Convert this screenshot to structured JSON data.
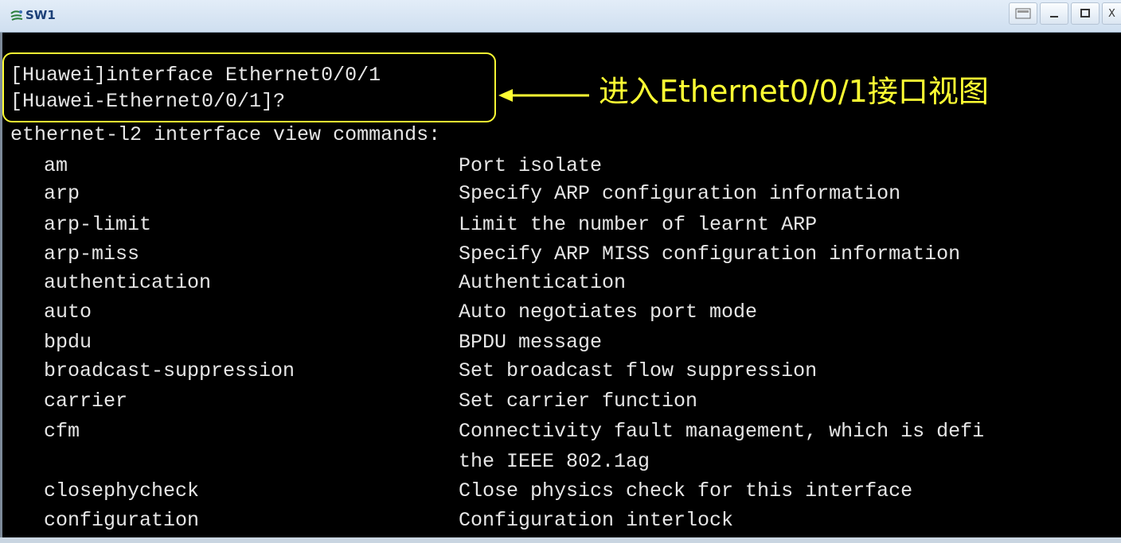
{
  "window": {
    "title": "SW1",
    "controls": [
      "minimize",
      "maximize",
      "close"
    ],
    "close_label": "X"
  },
  "terminal": {
    "lines": [
      "[Huawei]interface Ethernet0/0/1",
      "[Huawei-Ethernet0/0/1]?",
      "ethernet-l2 interface view commands:"
    ],
    "commands": [
      {
        "cmd": "am",
        "desc": "Port isolate"
      },
      {
        "cmd": "arp",
        "desc": "Specify ARP configuration information"
      },
      {
        "cmd": "arp-limit",
        "desc": "Limit the number of learnt ARP"
      },
      {
        "cmd": "arp-miss",
        "desc": "Specify ARP MISS configuration information"
      },
      {
        "cmd": "authentication",
        "desc": "Authentication"
      },
      {
        "cmd": "auto",
        "desc": "Auto negotiates port mode"
      },
      {
        "cmd": "bpdu",
        "desc": "BPDU message"
      },
      {
        "cmd": "broadcast-suppression",
        "desc": "Set broadcast flow suppression"
      },
      {
        "cmd": "carrier",
        "desc": "Set carrier function"
      },
      {
        "cmd": "cfm",
        "desc": "Connectivity fault management, which is defi"
      },
      {
        "cmd": "",
        "desc": "the IEEE 802.1ag"
      },
      {
        "cmd": "closephycheck",
        "desc": "Close physics check for this interface"
      },
      {
        "cmd": "configuration",
        "desc": "Configuration interlock"
      }
    ]
  },
  "annotation": {
    "text": "进入Ethernet0/0/1接口视图",
    "color": "#ffff33"
  },
  "colors": {
    "terminal_bg": "#000000",
    "terminal_fg": "#e6e6e6",
    "highlight": "#ffff33"
  }
}
